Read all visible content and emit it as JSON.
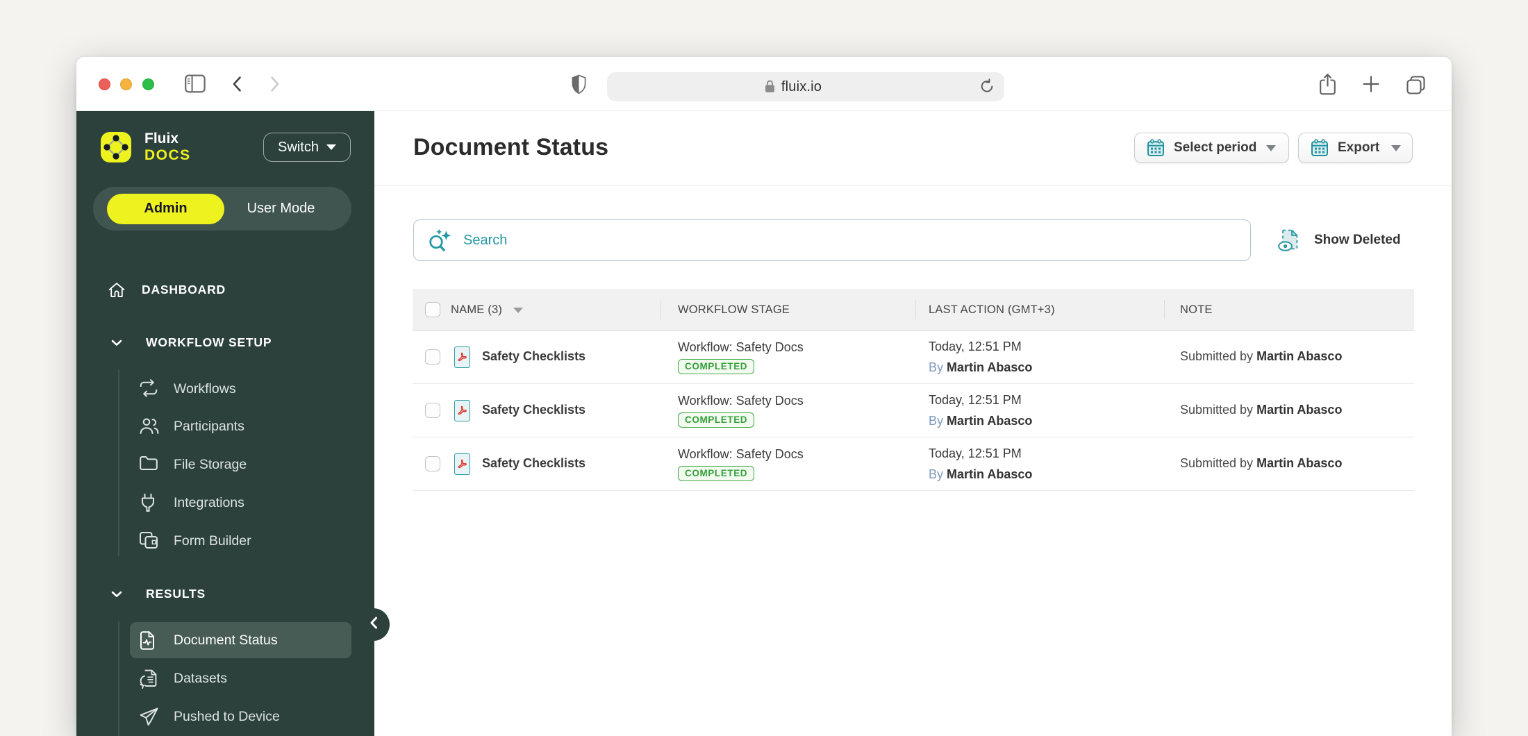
{
  "browser": {
    "url": "fluix.io",
    "window_controls": [
      "close",
      "minimize",
      "zoom"
    ]
  },
  "sidebar": {
    "brand": "Fluix",
    "product": "DOCS",
    "switch_label": "Switch",
    "mode_toggle": {
      "active": "Admin",
      "inactive": "User Mode"
    },
    "dashboard_label": "DASHBOARD",
    "workflow_setup_label": "WORKFLOW SETUP",
    "workflow_items": [
      {
        "label": "Workflows"
      },
      {
        "label": "Participants"
      },
      {
        "label": "File Storage"
      },
      {
        "label": "Integrations"
      },
      {
        "label": "Form Builder"
      }
    ],
    "results_label": "RESULTS",
    "results_items": [
      {
        "label": "Document Status",
        "selected": true
      },
      {
        "label": "Datasets"
      },
      {
        "label": "Pushed to Device"
      }
    ]
  },
  "main": {
    "title": "Document Status",
    "select_period_label": "Select period",
    "export_label": "Export",
    "search_placeholder": "Search",
    "show_deleted_label": "Show Deleted",
    "table": {
      "columns": [
        "NAME (3)",
        "WORKFLOW STAGE",
        "LAST ACTION (GMT+3)",
        "NOTE"
      ],
      "rows": [
        {
          "name": "Safety Checklists",
          "stage": "Workflow: Safety Docs",
          "status": "COMPLETED",
          "time": "Today, 12:51 PM",
          "by_prefix": "By",
          "by_name": "Martin Abasco",
          "note_prefix": "Submitted by",
          "note_name": "Martin Abasco"
        },
        {
          "name": "Safety Checklists",
          "stage": "Workflow: Safety Docs",
          "status": "COMPLETED",
          "time": "Today, 12:51 PM",
          "by_prefix": "By",
          "by_name": "Martin Abasco",
          "note_prefix": "Submitted by",
          "note_name": "Martin Abasco"
        },
        {
          "name": "Safety Checklists",
          "stage": "Workflow: Safety Docs",
          "status": "COMPLETED",
          "time": "Today, 12:51 PM",
          "by_prefix": "By",
          "by_name": "Martin Abasco",
          "note_prefix": "Submitted by",
          "note_name": "Martin Abasco"
        }
      ]
    }
  },
  "colors": {
    "sidebar_bg": "#2c413c",
    "accent_yellow": "#eef21e",
    "accent_teal": "#2397a4",
    "badge_green": "#41ab47",
    "page_bg": "#f4f3f0"
  }
}
